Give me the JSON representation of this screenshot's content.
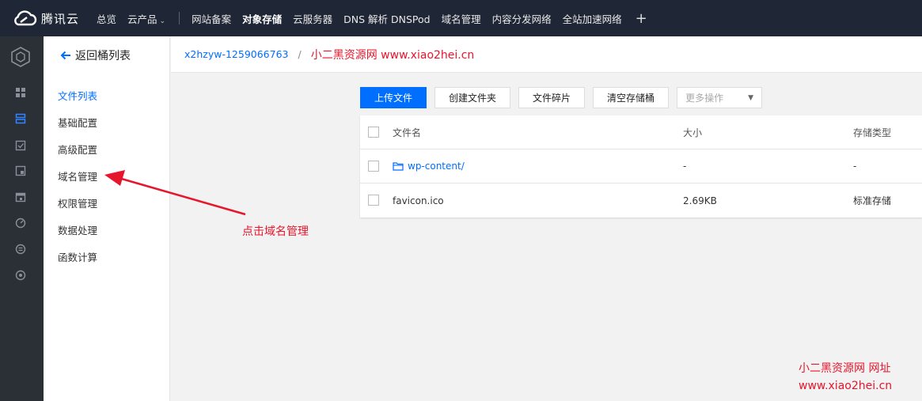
{
  "topbar": {
    "brand": "腾讯云",
    "items": [
      {
        "label": "总览"
      },
      {
        "label": "云产品"
      },
      {
        "label": "网站备案"
      },
      {
        "label": "对象存储"
      },
      {
        "label": "云服务器"
      },
      {
        "label": "DNS 解析 DNSPod"
      },
      {
        "label": "域名管理"
      },
      {
        "label": "内容分发网络"
      },
      {
        "label": "全站加速网络"
      }
    ],
    "plus": "+"
  },
  "rail": {
    "icons": [
      "dashboard-icon",
      "storage-icon",
      "task-icon",
      "report-icon",
      "calendar-icon",
      "monitor-icon",
      "list-icon",
      "settings-icon"
    ]
  },
  "subnav": {
    "back_label": "返回桶列表",
    "items": [
      {
        "label": "文件列表",
        "active": true
      },
      {
        "label": "基础配置"
      },
      {
        "label": "高级配置"
      },
      {
        "label": "域名管理"
      },
      {
        "label": "权限管理"
      },
      {
        "label": "数据处理"
      },
      {
        "label": "函数计算"
      }
    ]
  },
  "breadcrumb": {
    "bucket": "x2hzyw-1259066763",
    "separator": "/",
    "watermark": "小二黑资源网 www.xiao2hei.cn"
  },
  "toolbar": {
    "upload": "上传文件",
    "create_folder": "创建文件夹",
    "fragments": "文件碎片",
    "clear_bucket": "清空存储桶",
    "more": "更多操作"
  },
  "table": {
    "headers": {
      "name": "文件名",
      "size": "大小",
      "type": "存储类型"
    },
    "rows": [
      {
        "name": "wp-content/",
        "size": "-",
        "type": "-",
        "is_folder": true
      },
      {
        "name": "favicon.ico",
        "size": "2.69KB",
        "type": "标准存储",
        "is_folder": false
      }
    ]
  },
  "annotation": {
    "text": "点击域名管理",
    "color": "#e6162d"
  },
  "watermark_bottom": {
    "line1": "小二黑资源网 网址",
    "line2": "www.xiao2hei.cn"
  },
  "colors": {
    "accent": "#006eff",
    "topbar": "#1f2635",
    "rail": "#2b2f36",
    "annotation": "#e6162d"
  }
}
